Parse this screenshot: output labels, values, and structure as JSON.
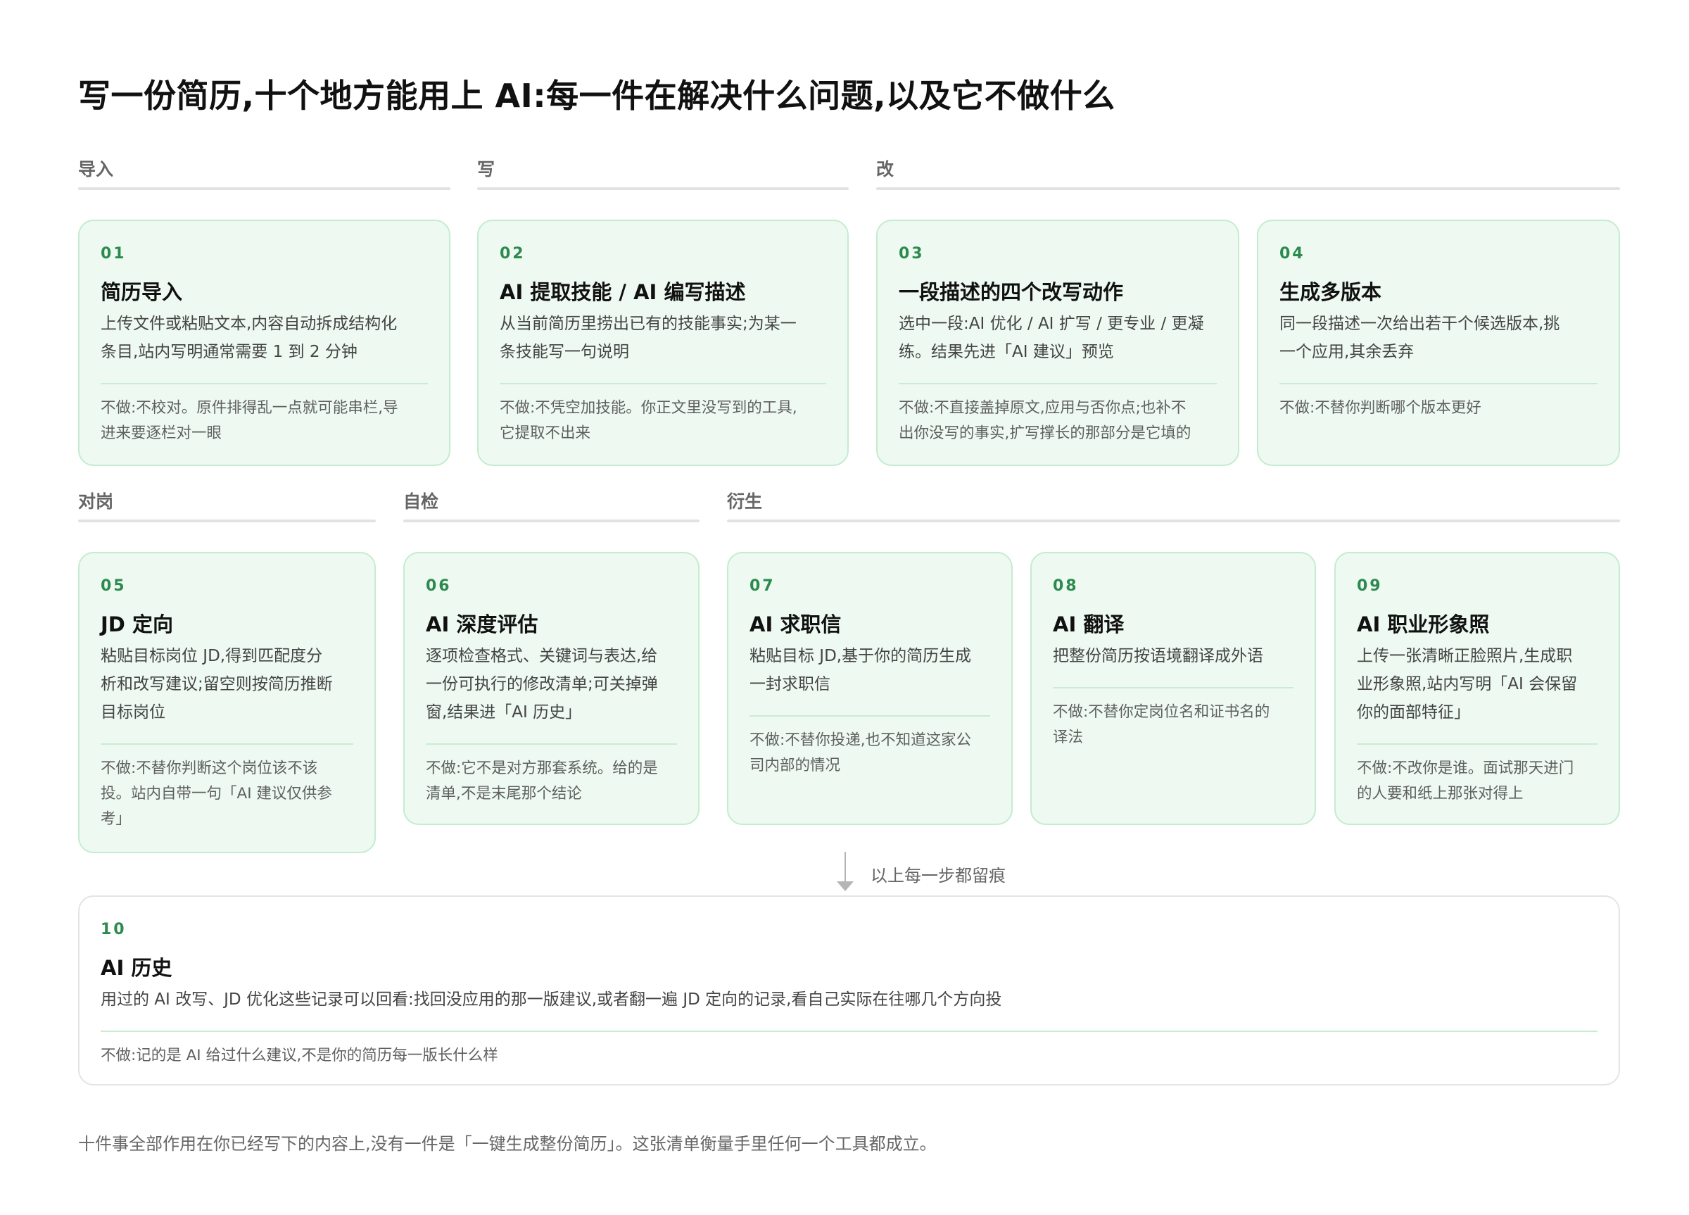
{
  "title": "写一份简历,十个地方能用上 AI:每一件在解决什么问题,以及它不做什么",
  "sections": {
    "import": "导入",
    "write": "写",
    "revise": "改",
    "target": "对岗",
    "selfcheck": "自检",
    "derive": "衍生"
  },
  "cards": [
    {
      "num": "01",
      "title": "简历导入",
      "desc_lines": [
        "上传文件或粘贴文本,内容自动拆成结构化",
        "条目,站内写明通常需要 1 到 2 分钟"
      ],
      "not_lines": [
        "不做:不校对。原件排得乱一点就可能串栏,导",
        "进来要逐栏对一眼"
      ]
    },
    {
      "num": "02",
      "title": "AI 提取技能 / AI 编写描述",
      "desc_lines": [
        "从当前简历里捞出已有的技能事实;为某一",
        "条技能写一句说明"
      ],
      "not_lines": [
        "不做:不凭空加技能。你正文里没写到的工具,",
        "它提取不出来"
      ]
    },
    {
      "num": "03",
      "title": "一段描述的四个改写动作",
      "desc_lines": [
        "选中一段:AI 优化 / AI 扩写 / 更专业 / 更凝",
        "练。结果先进「AI 建议」预览"
      ],
      "not_lines": [
        "不做:不直接盖掉原文,应用与否你点;也补不",
        "出你没写的事实,扩写撑长的那部分是它填的"
      ]
    },
    {
      "num": "04",
      "title": "生成多版本",
      "desc_lines": [
        "同一段描述一次给出若干个候选版本,挑",
        "一个应用,其余丢弃"
      ],
      "not_lines": [
        "不做:不替你判断哪个版本更好"
      ]
    },
    {
      "num": "05",
      "title": "JD 定向",
      "desc_lines": [
        "粘贴目标岗位 JD,得到匹配度分",
        "析和改写建议;留空则按简历推断",
        "目标岗位"
      ],
      "not_lines": [
        "不做:不替你判断这个岗位该不该",
        "投。站内自带一句「AI 建议仅供参",
        "考」"
      ]
    },
    {
      "num": "06",
      "title": "AI 深度评估",
      "desc_lines": [
        "逐项检查格式、关键词与表达,给",
        "一份可执行的修改清单;可关掉弹",
        "窗,结果进「AI 历史」"
      ],
      "not_lines": [
        "不做:它不是对方那套系统。给的是",
        "清单,不是末尾那个结论"
      ]
    },
    {
      "num": "07",
      "title": "AI 求职信",
      "desc_lines": [
        "粘贴目标 JD,基于你的简历生成",
        "一封求职信"
      ],
      "not_lines": [
        "不做:不替你投递,也不知道这家公",
        "司内部的情况"
      ]
    },
    {
      "num": "08",
      "title": "AI 翻译",
      "desc_lines": [
        "把整份简历按语境翻译成外语"
      ],
      "not_lines": [
        "不做:不替你定岗位名和证书名的",
        "译法"
      ]
    },
    {
      "num": "09",
      "title": "AI 职业形象照",
      "desc_lines": [
        "上传一张清晰正脸照片,生成职",
        "业形象照,站内写明「AI 会保留",
        "你的面部特征」"
      ],
      "not_lines": [
        "不做:不改你是谁。面试那天进门",
        "的人要和纸上那张对得上"
      ]
    },
    {
      "num": "10",
      "title": "AI 历史",
      "desc_lines": [
        "用过的 AI 改写、JD 优化这些记录可以回看:找回没应用的那一版建议,或者翻一遍 JD 定向的记录,看自己实际在往哪几个方向投"
      ],
      "not_lines": [
        "不做:记的是 AI 给过什么建议,不是你的简历每一版长什么样"
      ]
    }
  ],
  "connector_label": "以上每一步都留痕",
  "footer": "十件事全部作用在你已经写下的内容上,没有一件是「一键生成整份简历」。这张清单衡量手里任何一个工具都成立。"
}
